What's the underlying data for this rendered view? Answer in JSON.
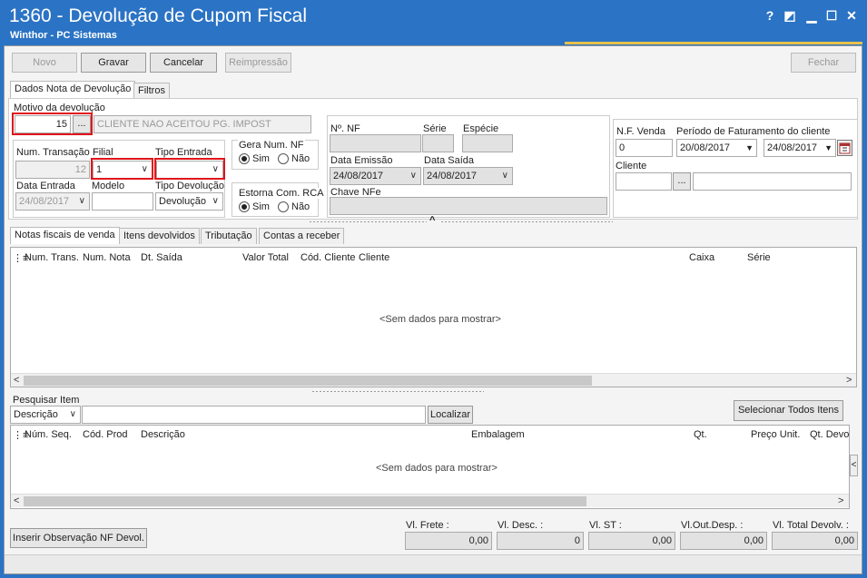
{
  "window": {
    "title": "1360 - Devolução de Cupom Fiscal",
    "subtitle": "Winthor - PC Sistemas",
    "help_label": "?",
    "restore_label": "◩",
    "minimize_label": "▁",
    "maximize_label": "☐",
    "close_label": "✕"
  },
  "toolbar": {
    "novo": "Novo",
    "gravar": "Gravar",
    "cancelar": "Cancelar",
    "reimpressao": "Reimpressão",
    "fechar": "Fechar"
  },
  "tabs_top": [
    "Dados Nota de Devolução",
    "Filtros"
  ],
  "dados": {
    "motivo_label": "Motivo da devolução",
    "motivo_code": "15",
    "motivo_btn": "...",
    "motivo_desc": "CLIENTE NAO ACEITOU PG. IMPOST",
    "num_transacao_label": "Num. Transação",
    "num_transacao": "12",
    "filial_label": "Filial",
    "filial": "1",
    "tipo_entrada_label": "Tipo Entrada",
    "tipo_entrada": "",
    "data_entrada_label": "Data Entrada",
    "data_entrada": "24/08/2017",
    "modelo_label": "Modelo",
    "modelo": "",
    "tipo_devolucao_label": "Tipo Devolução",
    "tipo_devolucao": "Devolução",
    "gera_num_nf_label": "Gera Num. NF",
    "sim": "Sim",
    "nao": "Não",
    "estorna_label": "Estorna Com. RCA",
    "nf_label": "Nº. NF",
    "serie_label": "Série",
    "especie_label": "Espécie",
    "data_emissao_label": "Data Emissão",
    "data_emissao": "24/08/2017",
    "data_saida_label": "Data Saída",
    "data_saida": "24/08/2017",
    "chave_nfe_label": "Chave NFe",
    "nf_venda_label": "N.F. Venda",
    "nf_venda": "0",
    "periodo_label": "Período de Faturamento do cliente",
    "periodo_ini": "20/08/2017",
    "periodo_fim": "24/08/2017",
    "cliente_label": "Cliente",
    "cliente_btn": "...",
    "collapse_label": "^"
  },
  "tabs_mid": [
    "Notas fiscais de venda",
    "Itens devolvidos",
    "Tributação",
    "Contas a receber"
  ],
  "grid1": {
    "columns": [
      "Num. Trans.",
      "Num. Nota",
      "Dt. Saída",
      "Valor Total",
      "Cód. Cliente",
      "Cliente",
      "Caixa",
      "Série"
    ],
    "empty": "<Sem dados para mostrar>"
  },
  "search": {
    "label": "Pesquisar Item",
    "mode": "Descrição",
    "value": "",
    "localizar": "Localizar",
    "selecionar_todos": "Selecionar Todos Itens"
  },
  "grid2": {
    "columns": [
      "Núm. Seq.",
      "Cód. Prod",
      "Descrição",
      "Embalagem",
      "Qt.",
      "Preço Unit.",
      "Qt. Devo"
    ],
    "empty": "<Sem dados para mostrar>"
  },
  "footer": {
    "inserir_obs": "Inserir Observação NF Devol.",
    "vl_frete_label": "Vl. Frete :",
    "vl_frete": "0,00",
    "vl_desc_label": "Vl. Desc. :",
    "vl_desc": "0",
    "vl_st_label": "Vl. ST :",
    "vl_st": "0,00",
    "vl_out_label": "Vl.Out.Desp. :",
    "vl_out": "0,00",
    "vl_total_label": "Vl. Total Devolv. :",
    "vl_total": "0,00"
  }
}
